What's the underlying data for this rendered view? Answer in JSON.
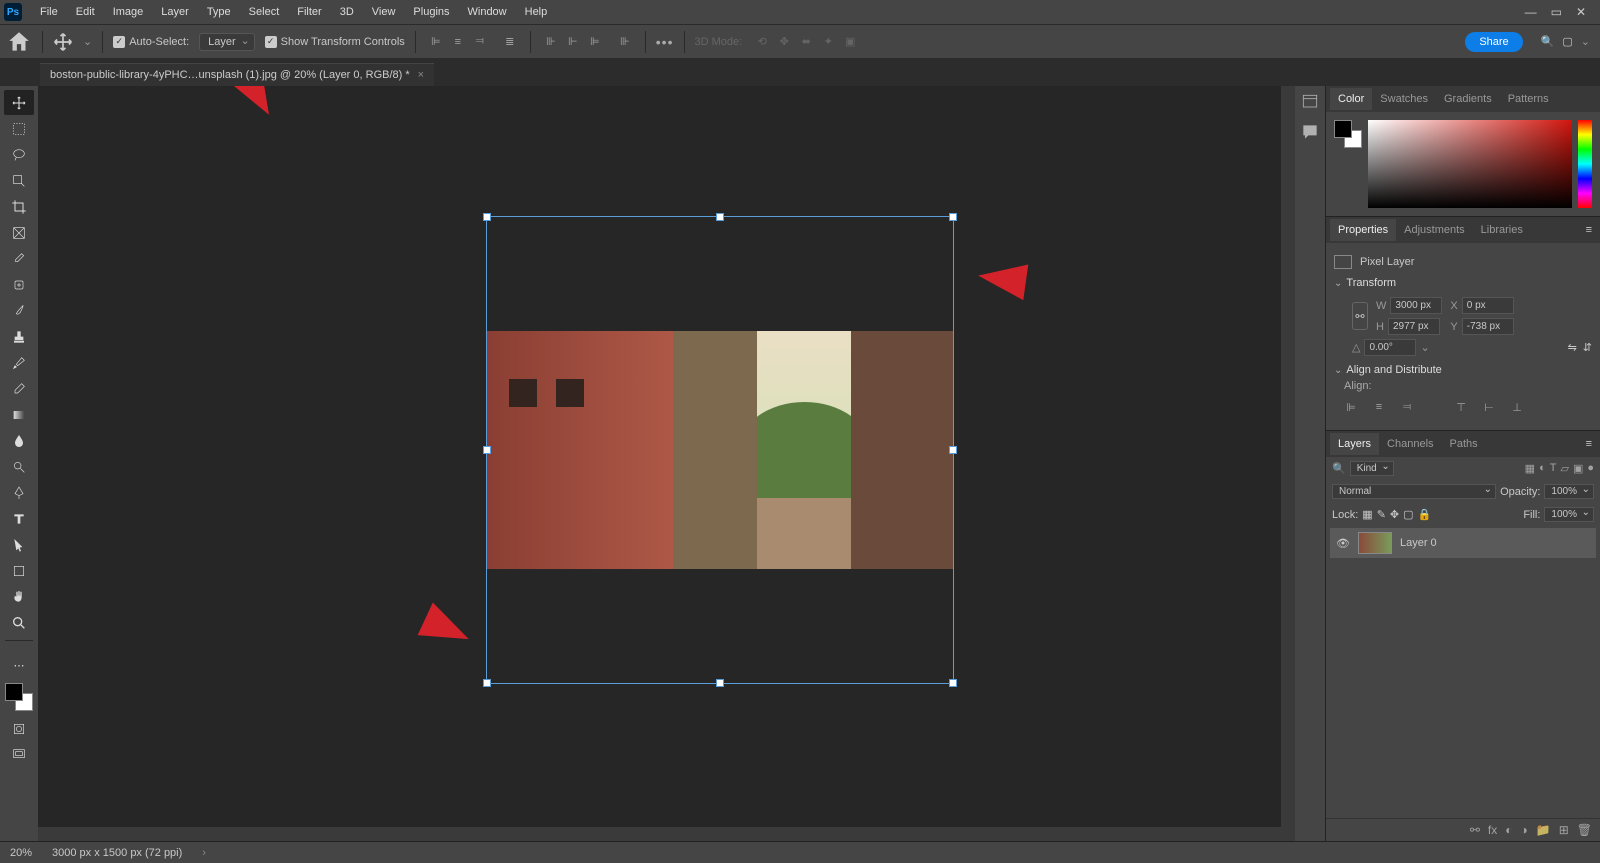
{
  "menubar": {
    "items": [
      "File",
      "Edit",
      "Image",
      "Layer",
      "Type",
      "Select",
      "Filter",
      "3D",
      "View",
      "Plugins",
      "Window",
      "Help"
    ]
  },
  "optionsbar": {
    "autoSelectLabel": "Auto-Select:",
    "autoSelectValue": "Layer",
    "showTransform": "Show Transform Controls",
    "mode3d": "3D Mode:",
    "share": "Share"
  },
  "document": {
    "tabTitle": "boston-public-library-4yPHC…unsplash (1).jpg @ 20% (Layer 0, RGB/8) *"
  },
  "panels": {
    "colorTabs": [
      "Color",
      "Swatches",
      "Gradients",
      "Patterns"
    ],
    "propTabs": [
      "Properties",
      "Adjustments",
      "Libraries"
    ],
    "pixelLayer": "Pixel Layer",
    "transform": {
      "label": "Transform",
      "wLabel": "W",
      "w": "3000 px",
      "hLabel": "H",
      "h": "2977 px",
      "xLabel": "X",
      "x": "0 px",
      "yLabel": "Y",
      "y": "-738 px",
      "angleLabel": "△",
      "angle": "0.00°"
    },
    "alignDist": {
      "label": "Align and Distribute",
      "alignLabel": "Align:"
    },
    "layerTabs": [
      "Layers",
      "Channels",
      "Paths"
    ],
    "kind": "Kind",
    "blend": "Normal",
    "opacityLabel": "Opacity:",
    "opacity": "100%",
    "lockLabel": "Lock:",
    "fillLabel": "Fill:",
    "fill": "100%",
    "layer0": "Layer 0"
  },
  "statusbar": {
    "zoom": "20%",
    "dims": "3000 px x 1500 px (72 ppi)"
  }
}
